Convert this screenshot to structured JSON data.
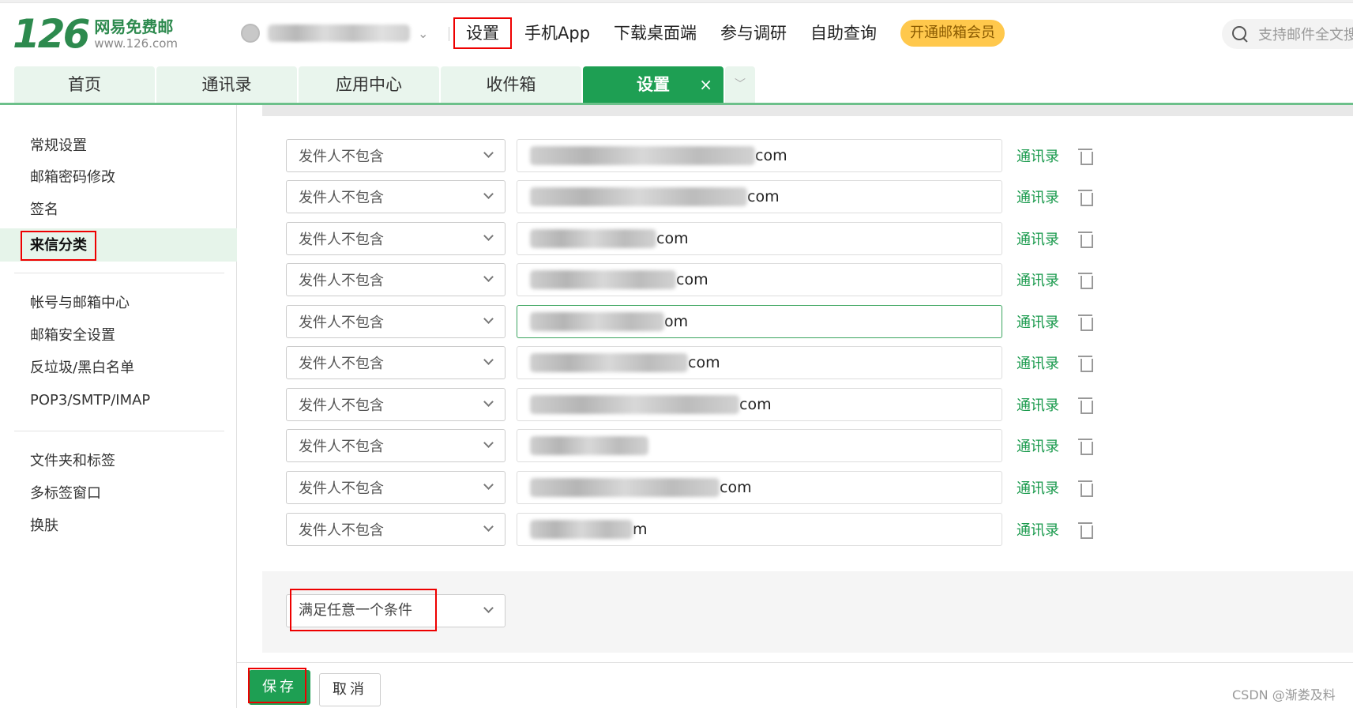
{
  "logo": {
    "number": "126",
    "name_cn": "网易免费邮",
    "domain": "www.126.com"
  },
  "topnav": {
    "settings": "设置",
    "mobile_app": "手机App",
    "download_desktop": "下载桌面端",
    "survey": "参与调研",
    "self_service": "自助查询",
    "vip": "开通邮箱会员"
  },
  "search": {
    "placeholder": "支持邮件全文搜索"
  },
  "tabs": {
    "home": "首页",
    "contacts": "通讯录",
    "apps": "应用中心",
    "inbox": "收件箱",
    "settings": "设置",
    "close": "×",
    "more": "﹀"
  },
  "sidebar": {
    "general": "常规设置",
    "password": "邮箱密码修改",
    "signature": "签名",
    "incoming_sort": "来信分类",
    "account_center": "帐号与邮箱中心",
    "security": "邮箱安全设置",
    "antispam": "反垃圾/黑白名单",
    "pop3": "POP3/SMTP/IMAP",
    "folders": "文件夹和标签",
    "multi_tab": "多标签窗口",
    "skin": "换肤"
  },
  "rules": [
    {
      "condition": "发件人不包含",
      "value_suffix": "com",
      "contacts_link": "通讯录"
    },
    {
      "condition": "发件人不包含",
      "value_suffix": "com",
      "contacts_link": "通讯录"
    },
    {
      "condition": "发件人不包含",
      "value_suffix": "com",
      "contacts_link": "通讯录"
    },
    {
      "condition": "发件人不包含",
      "value_suffix": "com",
      "contacts_link": "通讯录"
    },
    {
      "condition": "发件人不包含",
      "value_suffix": "om",
      "contacts_link": "通讯录"
    },
    {
      "condition": "发件人不包含",
      "value_suffix": "com",
      "contacts_link": "通讯录"
    },
    {
      "condition": "发件人不包含",
      "value_suffix": "com",
      "contacts_link": "通讯录"
    },
    {
      "condition": "发件人不包含",
      "value_suffix": "",
      "contacts_link": "通讯录"
    },
    {
      "condition": "发件人不包含",
      "value_suffix": "com",
      "contacts_link": "通讯录"
    },
    {
      "condition": "发件人不包含",
      "value_suffix": "m",
      "contacts_link": "通讯录"
    }
  ],
  "match_mode": "满足任意一个条件",
  "actions": {
    "save": "保存",
    "cancel": "取消"
  },
  "watermark": "CSDN @渐娄及料",
  "colors": {
    "brand_green": "#1e9f53",
    "highlight_red": "#e00000",
    "vip_yellow": "#ffc84c"
  }
}
